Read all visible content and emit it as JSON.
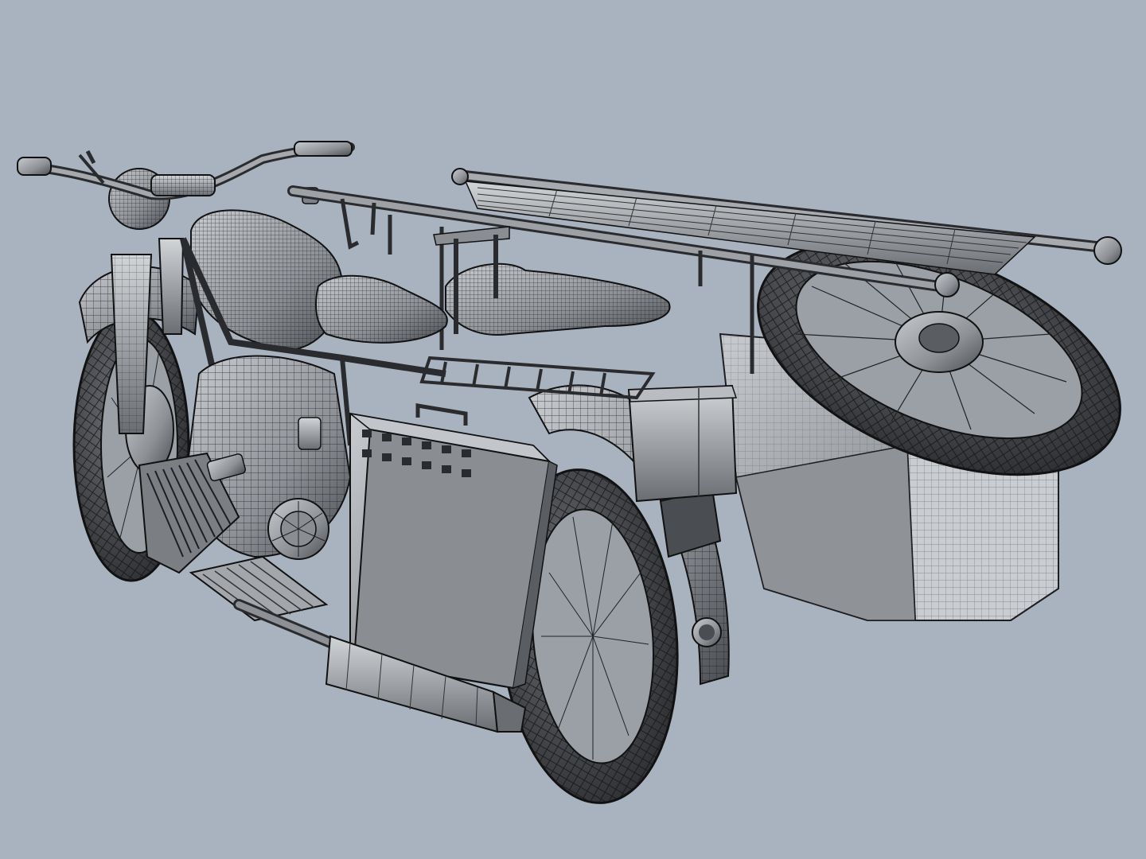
{
  "scene": {
    "background_color": "#a9b3bf",
    "shade_dark": "#3a3c40",
    "shade_mid": "#7d8186",
    "shade_light": "#c8cbcf",
    "wire_color": "#1e1f22"
  }
}
